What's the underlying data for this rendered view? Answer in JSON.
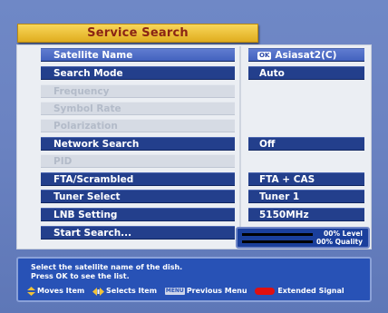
{
  "title": "Service Search",
  "menu": {
    "items": [
      {
        "label": "Satellite Name",
        "value": "Asiasat2(C)",
        "ok_badge": "OK",
        "state": "selected"
      },
      {
        "label": "Search Mode",
        "value": "Auto",
        "state": "normal"
      },
      {
        "label": "Frequency",
        "state": "disabled"
      },
      {
        "label": "Symbol Rate",
        "state": "disabled"
      },
      {
        "label": "Polarization",
        "state": "disabled"
      },
      {
        "label": "Network Search",
        "value": "Off",
        "state": "normal"
      },
      {
        "label": "PID",
        "state": "disabled"
      },
      {
        "label": "FTA/Scrambled",
        "value": "FTA + CAS",
        "state": "normal"
      },
      {
        "label": "Tuner Select",
        "value": "Tuner 1",
        "state": "normal"
      },
      {
        "label": "LNB Setting",
        "value": "5150MHz",
        "state": "normal"
      },
      {
        "label": "Start Search...",
        "state": "normal"
      }
    ]
  },
  "signal": {
    "level_text": "00% Level",
    "quality_text": "00% Quality",
    "level_percent": 0,
    "quality_percent": 0
  },
  "help": {
    "line1": "Select the satellite name of the dish.",
    "line2": "Press OK to see the list.",
    "moves_item": "Moves Item",
    "selects_item": "Selects Item",
    "menu_key": "MENU",
    "previous_menu": "Previous Menu",
    "extended_signal": "Extended Signal"
  },
  "colors": {
    "background": "#6b83c2",
    "title_bar": "#f0c23a",
    "title_text": "#8a2414",
    "row_normal": "#233f8c",
    "row_selected": "#5170c8",
    "row_disabled": "#d6dbe4",
    "info_panel": "#2852b6",
    "red_key": "#e01010"
  }
}
